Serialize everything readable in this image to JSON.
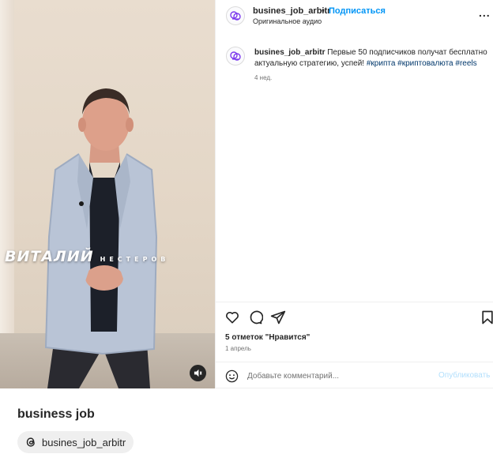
{
  "post": {
    "video": {
      "overlay_first_name": "ВИТАЛИЙ",
      "overlay_last_name": "НЕСТЕРОВ",
      "sound_icon": "speaker-muted-icon"
    },
    "header": {
      "username": "busines_job_arbitr",
      "separator": "•",
      "follow_label": "Подписаться",
      "audio_label": "Оригинальное аудио",
      "more_label": "...",
      "avatar_icon": "brain-logo-icon"
    },
    "caption": {
      "username": "busines_job_arbitr",
      "text": " Первые 50 подписчиков получат бесплатно актуальную стратегию, успей! ",
      "hashtags": [
        "#крипта",
        "#криптовалюта",
        "#reels"
      ],
      "age": "4 нед."
    },
    "actions": {
      "like_icon": "heart-icon",
      "comment_icon": "comment-icon",
      "share_icon": "send-icon",
      "save_icon": "bookmark-icon"
    },
    "likes_text": "5 отметок \"Нравится\"",
    "date_text": "1 апрель",
    "comment": {
      "placeholder": "Добавьте комментарий...",
      "publish_label": "Опубликовать",
      "emoji_icon": "smiley-icon"
    }
  },
  "profile": {
    "name": "business job",
    "threads_handle": "busines_job_arbitr",
    "threads_icon": "threads-icon"
  },
  "colors": {
    "accent": "#0095f6",
    "hashtag": "#00376b",
    "muted_text": "#737373",
    "publish_disabled": "#b2dffc"
  }
}
